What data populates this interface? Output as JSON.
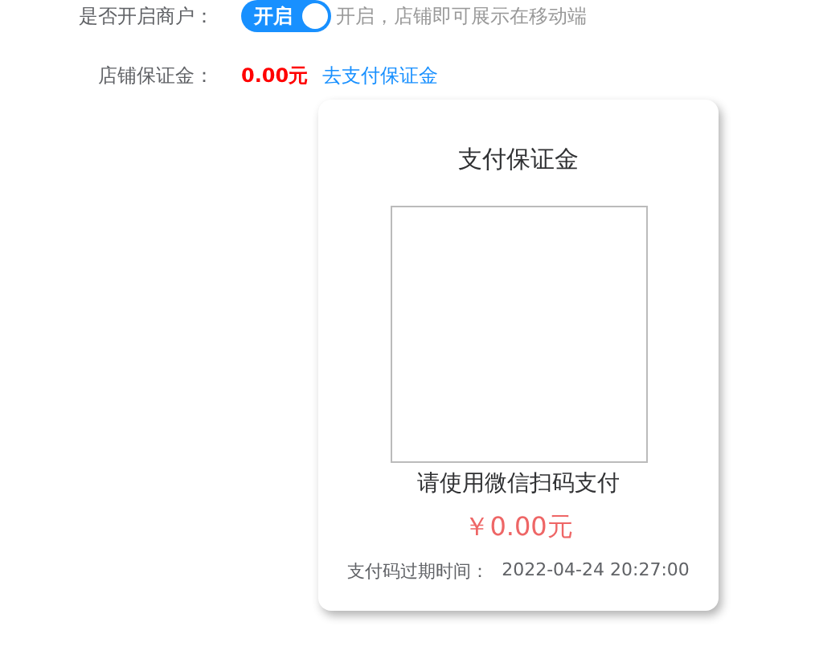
{
  "merchant_row": {
    "label": "是否开启商户：",
    "toggle": {
      "label": "开启",
      "on": true
    },
    "hint": "开启，店铺即可展示在移动端"
  },
  "deposit_row": {
    "label": "店铺保证金：",
    "amount": "0.00元",
    "link": "去支付保证金"
  },
  "pay_card": {
    "title": "支付保证金",
    "instruction": "请使用微信扫码支付",
    "price": "￥0.00元",
    "expiry_label": "支付码过期时间：",
    "expiry_time": "2022-04-24 20:27:00"
  }
}
